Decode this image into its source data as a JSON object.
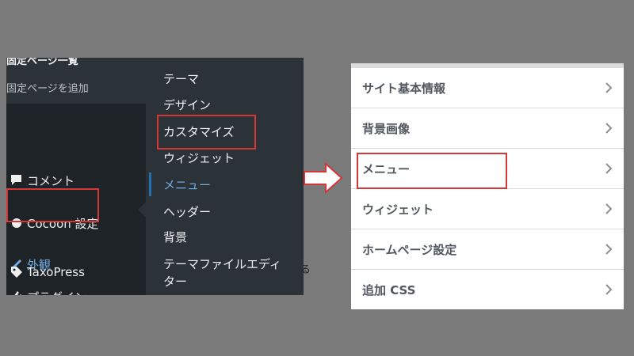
{
  "admin_menu": {
    "pages_submenu": {
      "all_pages": "固定ページ一覧",
      "add_new": "固定ページを追加"
    },
    "items": [
      {
        "label": "コメント",
        "icon": "comment-icon"
      },
      {
        "label": "Cocoon 設定",
        "icon": "circle-icon"
      },
      {
        "label": "外観",
        "icon": "paintbrush-icon"
      },
      {
        "label": "プラグイン",
        "icon": "plugin-icon"
      },
      {
        "label": "TaxoPress",
        "icon": "tag-icon"
      }
    ],
    "appearance_flyout": [
      {
        "label": "テーマ"
      },
      {
        "label": "デザイン"
      },
      {
        "label": "カスタマイズ"
      },
      {
        "label": "ウィジェット"
      },
      {
        "label": "メニュー"
      },
      {
        "label": "ヘッダー"
      },
      {
        "label": "背景"
      },
      {
        "label": "テーマファイルエディ"
      },
      {
        "label": "ター"
      }
    ],
    "edge_char": "る"
  },
  "customizer": {
    "sections": [
      {
        "label": "サイト基本情報"
      },
      {
        "label": "背景画像"
      },
      {
        "label": "メニュー"
      },
      {
        "label": "ウィジェット"
      },
      {
        "label": "ホームページ設定"
      },
      {
        "label": "追加 CSS"
      }
    ]
  },
  "colors": {
    "highlight_box": "#d63638",
    "admin_bg": "#1d2327",
    "submenu_bg": "#2c3338",
    "active_link": "#72aee6"
  }
}
